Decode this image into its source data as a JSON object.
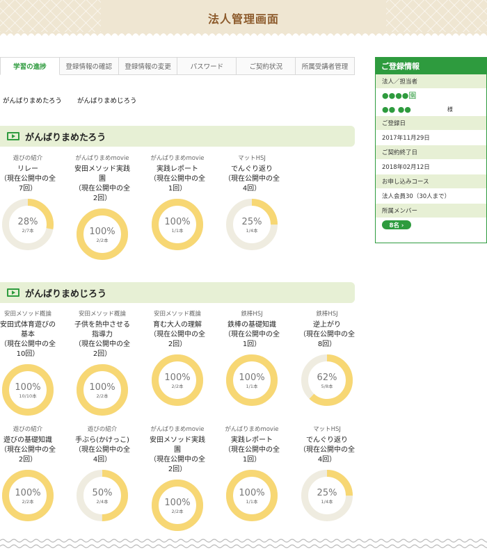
{
  "header": {
    "title": "法人管理画面"
  },
  "tabs": [
    {
      "label": "学習の進捗",
      "active": true
    },
    {
      "label": "登録情報の確認",
      "active": false
    },
    {
      "label": "登録情報の変更",
      "active": false
    },
    {
      "label": "パスワード",
      "active": false
    },
    {
      "label": "ご契約状況",
      "active": false
    },
    {
      "label": "所属受講者管理",
      "active": false
    }
  ],
  "students": [
    "がんばりまめたろう",
    "がんばりまめじろう"
  ],
  "sections": [
    {
      "name": "がんばりまめたろう",
      "courses": [
        {
          "category": "遊びの紹介",
          "title": "リレー\n（現在公開中の全\n7回）",
          "percent": "28%",
          "count": "2/7本",
          "progress": 0.28
        },
        {
          "category": "がんばりまめmovie",
          "title": "安田メソッド実践\n園\n（現在公開中の全\n2回）",
          "percent": "100%",
          "count": "2/2本",
          "progress": 1.0
        },
        {
          "category": "がんばりまめmovie",
          "title": "実践レポート\n（現在公開中の全\n1回）",
          "percent": "100%",
          "count": "1/1本",
          "progress": 1.0
        },
        {
          "category": "マットHSJ",
          "title": "でんぐり返り\n（現在公開中の全\n4回）",
          "percent": "25%",
          "count": "1/4本",
          "progress": 0.25
        }
      ]
    },
    {
      "name": "がんばりまめじろう",
      "courses": [
        {
          "category": "安田メソッド概論",
          "title": "安田式体育遊びの\n基本\n（現在公開中の全\n10回）",
          "percent": "100%",
          "count": "10/10本",
          "progress": 1.0
        },
        {
          "category": "安田メソッド概論",
          "title": "子供を熱中させる\n指導力\n（現在公開中の全\n2回）",
          "percent": "100%",
          "count": "2/2本",
          "progress": 1.0
        },
        {
          "category": "安田メソッド概論",
          "title": "育む大人の理解\n（現在公開中の全\n2回）",
          "percent": "100%",
          "count": "2/2本",
          "progress": 1.0
        },
        {
          "category": "鉄棒HSJ",
          "title": "鉄棒の基礎知識\n（現在公開中の全\n1回）",
          "percent": "100%",
          "count": "1/1本",
          "progress": 1.0
        },
        {
          "category": "鉄棒HSJ",
          "title": "逆上がり\n（現在公開中の全\n8回）",
          "percent": "62%",
          "count": "5/8本",
          "progress": 0.62
        },
        {
          "category": "遊びの紹介",
          "title": "遊びの基礎知識\n（現在公開中の全\n2回）",
          "percent": "100%",
          "count": "2/2本",
          "progress": 1.0
        },
        {
          "category": "遊びの紹介",
          "title": "手ぶら(かけっこ)\n（現在公開中の全\n4回）",
          "percent": "50%",
          "count": "2/4本",
          "progress": 0.5
        },
        {
          "category": "がんばりまめmovie",
          "title": "安田メソッド実践\n園\n（現在公開中の全\n2回）",
          "percent": "100%",
          "count": "2/2本",
          "progress": 1.0
        },
        {
          "category": "がんばりまめmovie",
          "title": "実践レポート\n（現在公開中の全\n1回）",
          "percent": "100%",
          "count": "1/1本",
          "progress": 1.0
        },
        {
          "category": "マットHSJ",
          "title": "でんぐり返り\n（現在公開中の全\n4回）",
          "percent": "25%",
          "count": "1/4本",
          "progress": 0.25
        }
      ]
    }
  ],
  "sidebar": {
    "title": "ご登録情報",
    "corp_label": "法人／担当者",
    "corp_name": "●●●●園",
    "person": "●● ●●",
    "honorific": "様",
    "reg_date_label": "ご登録日",
    "reg_date": "2017年11月29日",
    "end_date_label": "ご契約終了日",
    "end_date": "2018年02月12日",
    "course_label": "お申し込みコース",
    "course": "法人会員30（30人まで）",
    "members_label": "所属メンバー",
    "members_button": "8名 ›"
  },
  "colors": {
    "accent": "#2e9b3e",
    "ring_fill": "#f7d774",
    "ring_track": "#efece0",
    "section_bg": "#e7f0d5",
    "header_bg": "#efe6d2",
    "title_brown": "#8c5a2b"
  }
}
